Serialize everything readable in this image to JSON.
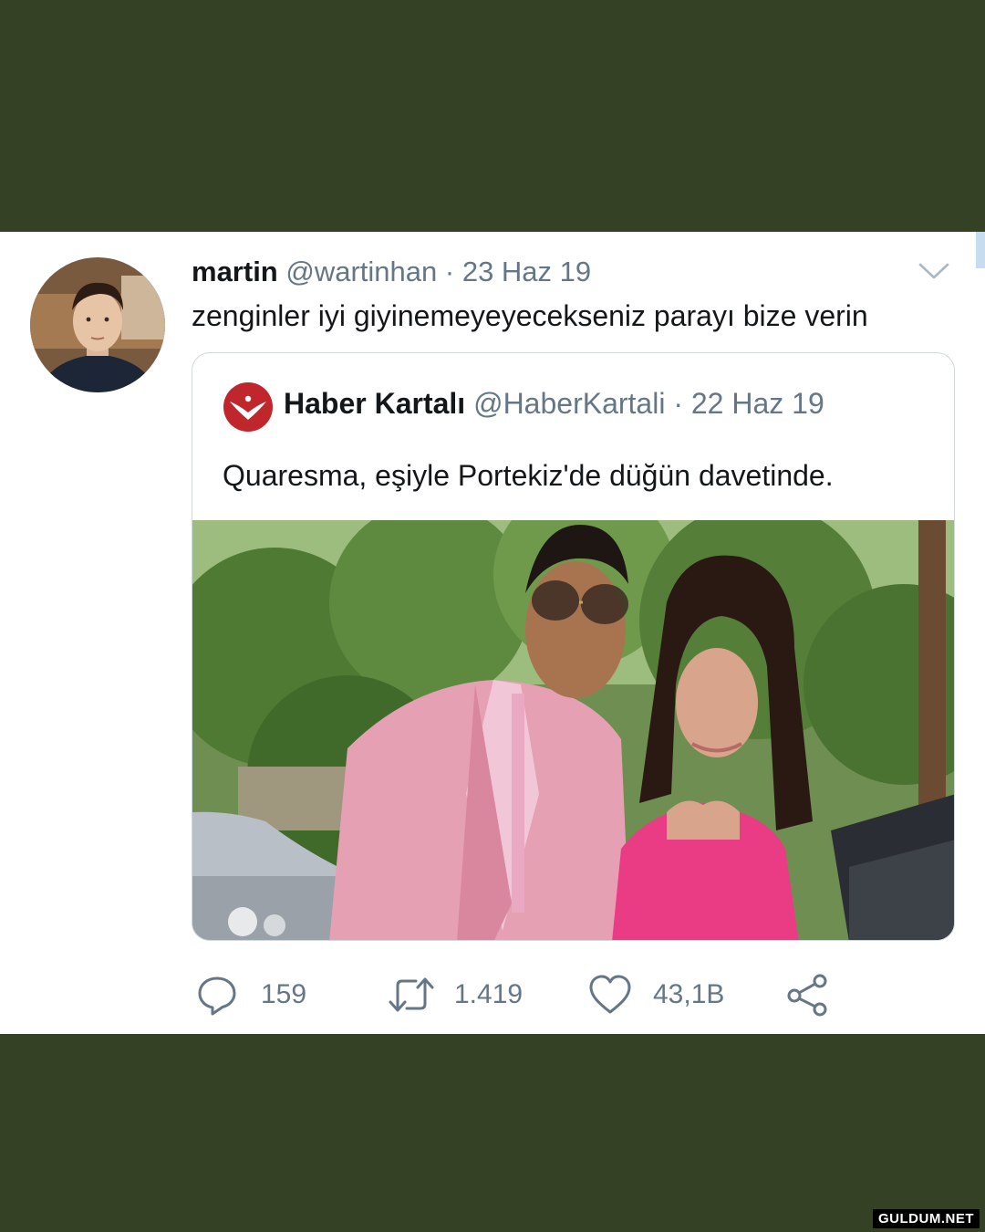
{
  "tweet": {
    "display_name": "martin",
    "handle": "@wartinhan",
    "separator": " · ",
    "date": "23 Haz 19",
    "text": "zenginler iyi giyinemeyeyecekseniz parayı bize verin"
  },
  "quoted_tweet": {
    "display_name": "Haber Kartalı",
    "handle": "@HaberKartali",
    "separator": " · ",
    "date": "22 Haz 19",
    "text": "Quaresma, eşiyle Portekiz'de düğün davetinde."
  },
  "actions": {
    "replies": "159",
    "retweets": "1.419",
    "likes": "43,1B"
  },
  "watermark": "GULDUM.NET",
  "colors": {
    "background": "#344124",
    "card": "#ffffff",
    "text_primary": "#14171a",
    "text_secondary": "#657786",
    "logo_red": "#c0272d"
  },
  "icons": [
    "chevron-down-icon",
    "reply-icon",
    "retweet-icon",
    "like-icon",
    "share-icon"
  ]
}
